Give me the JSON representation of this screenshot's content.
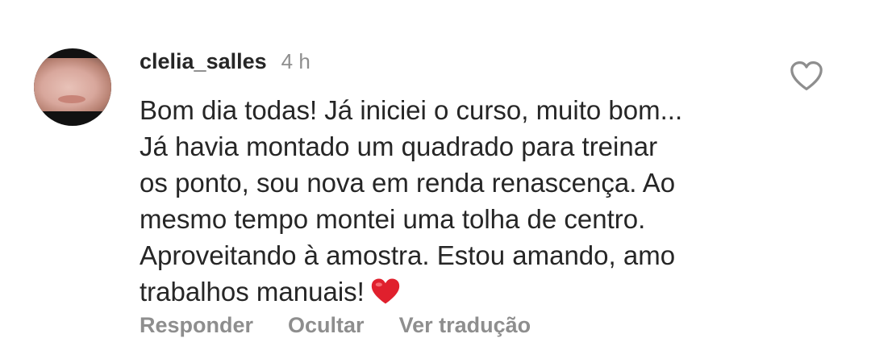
{
  "comment": {
    "username": "clelia_salles",
    "time": "4 h",
    "lines": [
      "Bom dia todas! Já iniciei o curso, muito bom...",
      "Já havia montado um quadrado para treinar",
      "os ponto, sou nova em renda renascença. Ao",
      "mesmo tempo montei uma tolha de centro.",
      "Aproveitando à amostra. Estou amando, amo",
      "trabalhos manuais!"
    ],
    "emoji": "red-heart-emoji",
    "like_icon": "heart-outline-icon"
  },
  "actions": {
    "reply": "Responder",
    "hide": "Ocultar",
    "translate": "Ver tradução"
  },
  "colors": {
    "text": "#262626",
    "secondary": "#8e8e8e",
    "heart": "#e0202d"
  }
}
